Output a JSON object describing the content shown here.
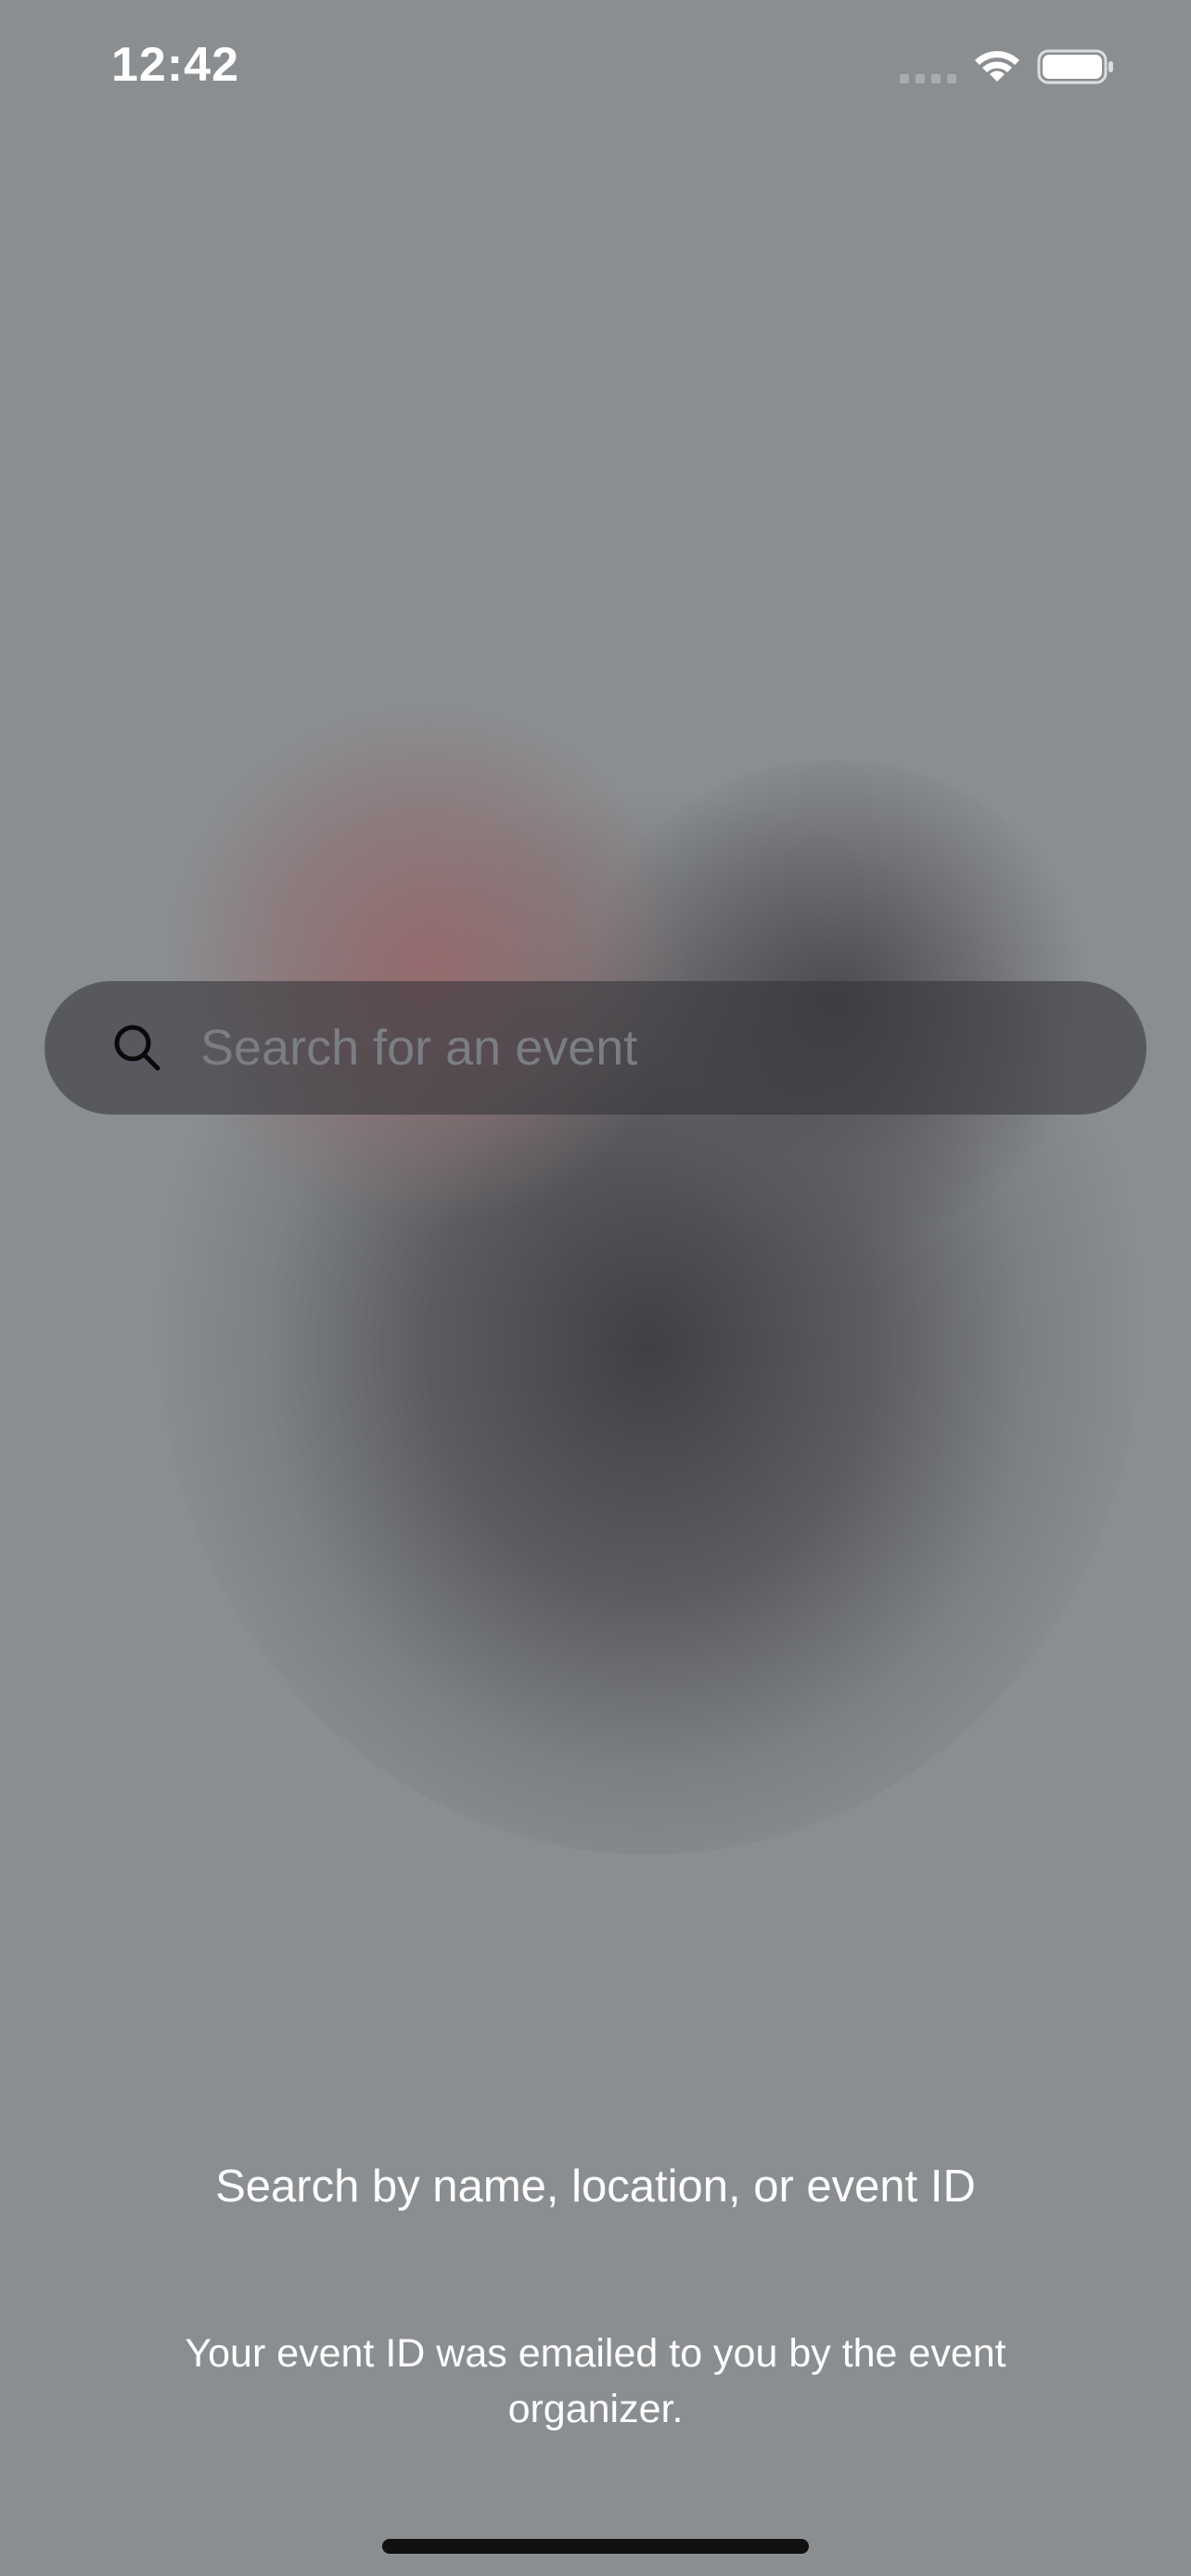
{
  "status_bar": {
    "time": "12:42",
    "signal_icon": "cellular-signal-dots-icon",
    "wifi_icon": "wifi-icon",
    "battery_icon": "battery-full-icon"
  },
  "search": {
    "placeholder": "Search for an event",
    "value": "",
    "icon": "search-icon"
  },
  "hint": {
    "title": "Search by name, location, or event ID",
    "subtitle": "Your event ID was emailed to you by the event organizer."
  },
  "colors": {
    "background": "#8b8e91",
    "search_bar": "#4a4a4e",
    "placeholder": "#7b7e84",
    "text": "#ffffff"
  }
}
